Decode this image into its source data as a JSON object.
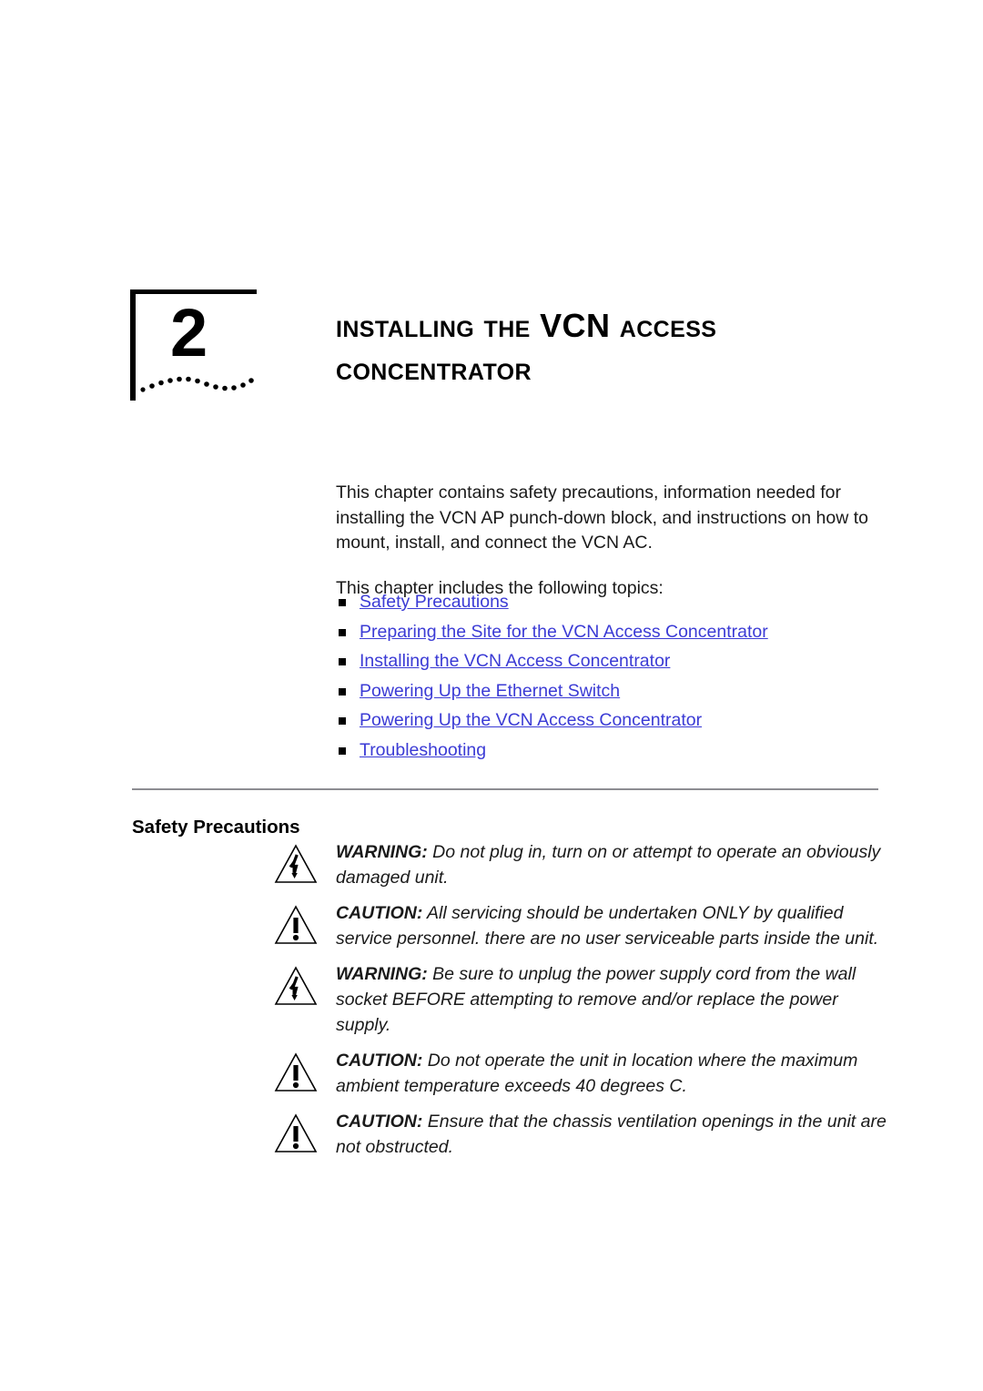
{
  "chapter": {
    "number": "2",
    "marker_icon": "chapter-bracket-wave-icon",
    "title_line1_pre": "Installing the ",
    "title_line1_kw": "VCN",
    "title_line1_post": " Access",
    "title_line2": "Concentrator",
    "title_full": "Installing the VCN Access Concentrator"
  },
  "intro": {
    "paragraph1": "This chapter contains safety precautions, information needed for installing the VCN AP punch-down block, and instructions on how to mount, install, and connect the VCN AC.",
    "paragraph2": "This chapter includes the following topics:"
  },
  "topics": {
    "bullet_icon": "square-bullet-icon",
    "link_color": "#3b3bd5",
    "items": [
      {
        "label": "Safety Precautions"
      },
      {
        "label": "Preparing the Site for the VCN Access Concentrator"
      },
      {
        "label": "Installing the VCN Access Concentrator"
      },
      {
        "label": "Powering Up the Ethernet Switch"
      },
      {
        "label": "Powering Up the VCN Access Concentrator"
      },
      {
        "label": "Troubleshooting"
      }
    ]
  },
  "section": {
    "heading": "Safety Precautions",
    "rule_color": "#8d8d92"
  },
  "notices": [
    {
      "icon": "warning-lightning-triangle-icon",
      "label": "WARNING:",
      "text": " Do not plug in, turn on or attempt to operate an obviously damaged unit."
    },
    {
      "icon": "caution-exclamation-triangle-icon",
      "label": "CAUTION:",
      "text": " All servicing should be undertaken ONLY by qualified service personnel. there are no user serviceable parts inside the unit."
    },
    {
      "icon": "warning-lightning-triangle-icon",
      "label": "WARNING:",
      "text": " Be sure to unplug the power supply cord from the wall socket BEFORE attempting to remove and/or replace the power supply."
    },
    {
      "icon": "caution-exclamation-triangle-icon",
      "label": "CAUTION:",
      "text": " Do not operate the unit in location where the maximum ambient temperature exceeds 40 degrees C."
    },
    {
      "icon": "caution-exclamation-triangle-icon",
      "label": "CAUTION:",
      "text": " Ensure that the chassis ventilation openings in the unit are not obstructed."
    }
  ]
}
